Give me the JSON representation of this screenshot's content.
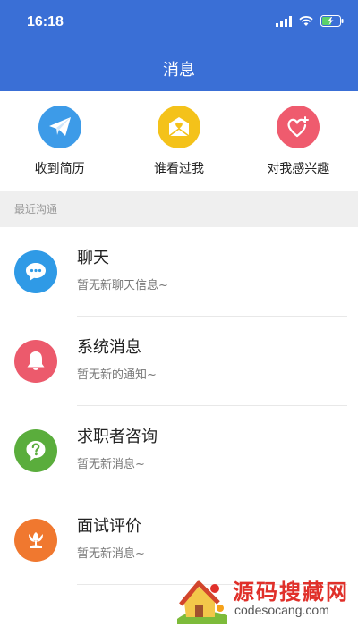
{
  "status_bar": {
    "time": "16:18"
  },
  "header": {
    "title": "消息"
  },
  "quick_actions": [
    {
      "label": "收到简历",
      "icon": "paper-plane-icon",
      "color": "#3d9be8"
    },
    {
      "label": "谁看过我",
      "icon": "mail-heart-icon",
      "color": "#f4c21a"
    },
    {
      "label": "对我感兴趣",
      "icon": "heart-plus-icon",
      "color": "#ef5b6e"
    }
  ],
  "section": {
    "title": "最近沟通"
  },
  "conversations": [
    {
      "title": "聊天",
      "subtitle": "暂无新聊天信息~",
      "icon": "chat-bubble-icon",
      "color": "#2f9ae6"
    },
    {
      "title": "系统消息",
      "subtitle": "暂无新的通知~",
      "icon": "bell-icon",
      "color": "#ec5a6c"
    },
    {
      "title": "求职者咨询",
      "subtitle": "暂无新消息~",
      "icon": "question-icon",
      "color": "#5aad3c"
    },
    {
      "title": "面试评价",
      "subtitle": "暂无新消息~",
      "icon": "tulip-icon",
      "color": "#f0782f"
    }
  ],
  "watermark": {
    "text": "源码搜藏网",
    "url": "codesocang.com"
  }
}
